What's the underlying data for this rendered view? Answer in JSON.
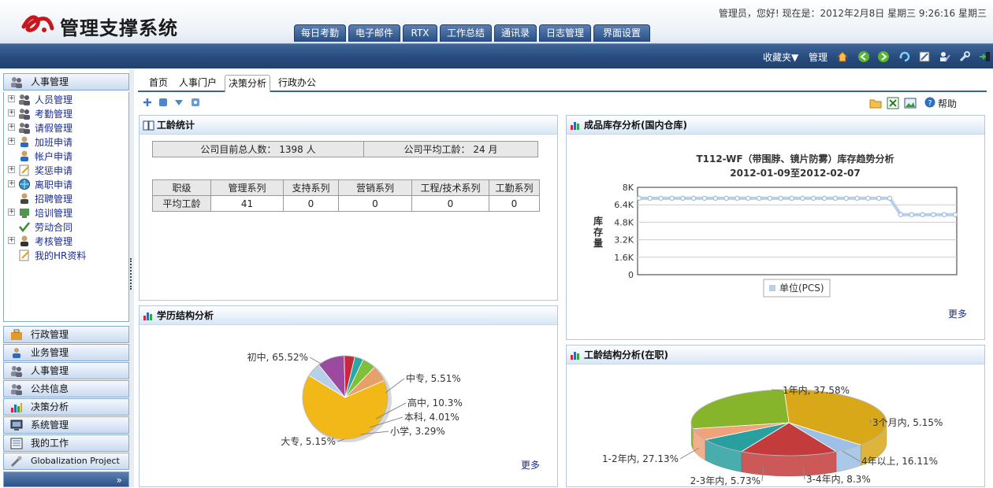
{
  "app": {
    "title": "管理支撑系统",
    "status": "管理员，您好! 现在是：2012年2月8日 星期三 9:26:16 星期三"
  },
  "topnav": [
    "每日考勤",
    "电子邮件",
    "RTX",
    "工作总结",
    "通讯录",
    "日志管理",
    "界面设置"
  ],
  "toolbar": {
    "favorites": "收藏夹▼",
    "admin": "管理"
  },
  "sidebar": {
    "section_title": "人事管理",
    "tree": [
      "人员管理",
      "考勤管理",
      "请假管理",
      "加班申请",
      "帐户申请",
      "奖惩申请",
      "离职申请",
      "招聘管理",
      "培训管理",
      "劳动合同",
      "考核管理",
      "我的HR资料"
    ],
    "accordion": [
      "行政管理",
      "业务管理",
      "人事管理",
      "公共信息",
      "决策分析",
      "系统管理",
      "我的工作",
      "Globalization Project"
    ]
  },
  "page_tabs": [
    "首页",
    "人事门户",
    "决策分析",
    "行政办公"
  ],
  "help_label": "帮助",
  "seniority_panel": {
    "title": "工龄统计",
    "total_label": "公司目前总人数： 1398 人",
    "avg_label": "公司平均工龄： 24 月",
    "headers": [
      "职级",
      "管理系列",
      "支持系列",
      "营销系列",
      "工程/技术系列",
      "工勤系列"
    ],
    "row": [
      "平均工龄",
      "41",
      "0",
      "0",
      "0",
      "0"
    ]
  },
  "inventory_panel": {
    "title": "成品库存分析(国内仓库)",
    "more": "更多"
  },
  "education_panel": {
    "title": "学历结构分析",
    "more": "更多"
  },
  "tenure_panel": {
    "title": "工龄结构分析(在职)"
  },
  "chart_data": [
    {
      "type": "line",
      "title": "T112-WF（带围脖、镜片防雾）库存趋势分析",
      "subtitle": "2012-01-09至2012-02-07",
      "ylabel": "库存量",
      "yticks": [
        "0",
        "1.6K",
        "3.2K",
        "4.8K",
        "6.4K",
        "8K"
      ],
      "ylim": [
        0,
        8000
      ],
      "grid": true,
      "legend": "bottom",
      "series": [
        {
          "name": "单位(PCS)",
          "color": "#b8cfe8",
          "values": [
            7000,
            7000,
            7000,
            7000,
            7000,
            7000,
            7000,
            7000,
            7000,
            7000,
            7000,
            7000,
            7000,
            7000,
            7000,
            7000,
            7000,
            7000,
            7000,
            7000,
            7000,
            7000,
            7000,
            7000,
            5500,
            5500,
            5500,
            5500,
            5500,
            5500
          ]
        }
      ]
    },
    {
      "type": "pie",
      "labels": [
        "初中, 65.52%",
        "中专, 5.51%",
        "高中, 10.3%",
        "本科, 4.01%",
        "小学, 3.29%",
        "大专, 5.15%"
      ],
      "slices": [
        {
          "name": "初中",
          "value": 65.52,
          "color": "#f2b817"
        },
        {
          "name": "中专",
          "value": 5.51,
          "color": "#b7cfe8"
        },
        {
          "name": "高中",
          "value": 10.3,
          "color": "#9b4aa0"
        },
        {
          "name": "本科",
          "value": 4.01,
          "color": "#c8283c"
        },
        {
          "name": "小学",
          "value": 3.29,
          "color": "#2aa7a2"
        },
        {
          "name": "大专",
          "value": 5.15,
          "color": "#7fbf3a"
        },
        {
          "name": "",
          "value": 6.22,
          "color": "#e8a06a"
        }
      ]
    },
    {
      "type": "pie",
      "labels": [
        "1年内, 37.58%",
        "3个月内, 5.15%",
        "4年以上, 16.11%",
        "3-4年内, 8.3%",
        "2-3年内, 5.73%",
        "1-2年内, 27.13%"
      ],
      "slices": [
        {
          "name": "1年内",
          "value": 37.58,
          "color": "#d9a819"
        },
        {
          "name": "3个月内",
          "value": 5.15,
          "color": "#9cc0e6"
        },
        {
          "name": "4年以上",
          "value": 16.11,
          "color": "#c43b3b"
        },
        {
          "name": "3-4年内",
          "value": 8.3,
          "color": "#2a9fa0"
        },
        {
          "name": "2-3年内",
          "value": 5.73,
          "color": "#f0a27a"
        },
        {
          "name": "1-2年内",
          "value": 27.13,
          "color": "#86b52c"
        }
      ]
    }
  ]
}
